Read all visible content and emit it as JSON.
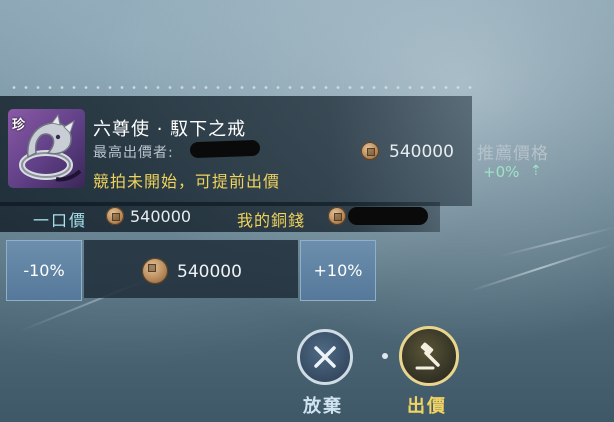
{
  "item": {
    "rarity_badge": "珍",
    "name": "六尊使 · 馭下之戒",
    "highest_bid_label": "最高出價者:",
    "status": "競拍未開始，可提前出價",
    "highest_price": "540000"
  },
  "recommend": {
    "label": "推薦價格",
    "value": "+0%"
  },
  "buyout": {
    "label": "一口價",
    "value": "540000"
  },
  "my_coins": {
    "label": "我的銅錢"
  },
  "bid_controls": {
    "minus_label": "-10%",
    "plus_label": "+10%",
    "bid_value": "540000"
  },
  "actions": {
    "abandon_label": "放棄",
    "bid_label": "出價"
  },
  "icons": {
    "coin": "coin-icon",
    "abandon": "close-x-icon",
    "bid": "gavel-icon",
    "up": "arrow-up-icon",
    "item": "silver-dragon-ring-icon"
  },
  "colors": {
    "status_gold": "#f0d35c",
    "buyout_cyan": "#a8e2ee",
    "recommend_green": "#9ee3c5",
    "item_purple": "#7a4f9f"
  }
}
